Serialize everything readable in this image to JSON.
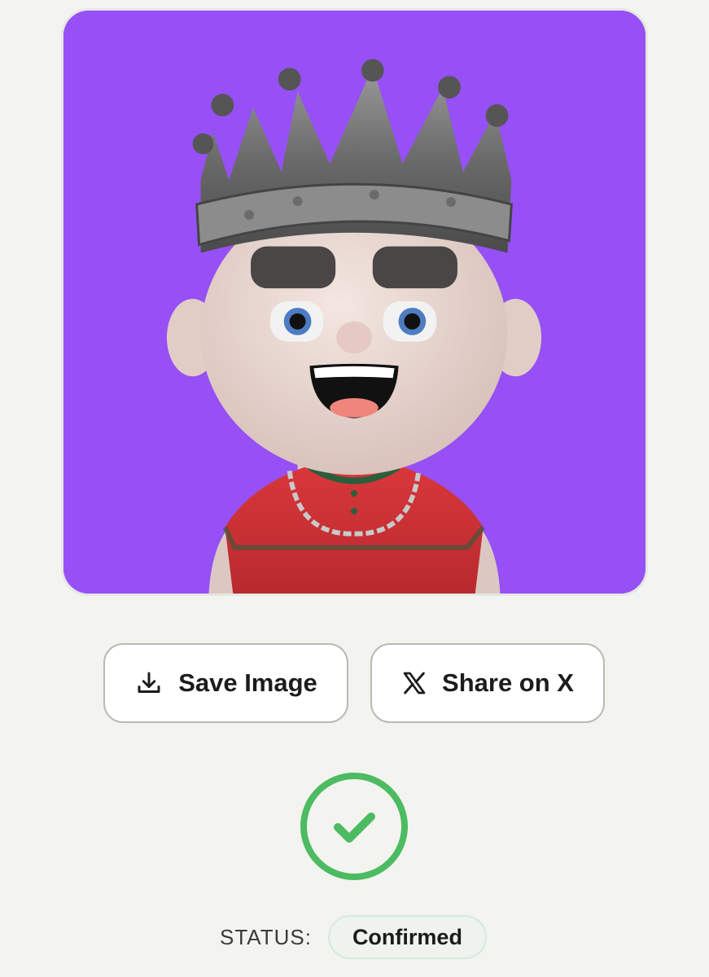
{
  "avatar": {
    "background_color": "#9650f5",
    "icon": "crowned-avatar-image"
  },
  "actions": {
    "save_label": "Save Image",
    "save_icon": "download-icon",
    "share_label": "Share on X",
    "share_icon": "x-logo-icon"
  },
  "status": {
    "icon": "check-circle-icon",
    "icon_color": "#4cbb61",
    "label": "STATUS:",
    "value": "Confirmed"
  }
}
